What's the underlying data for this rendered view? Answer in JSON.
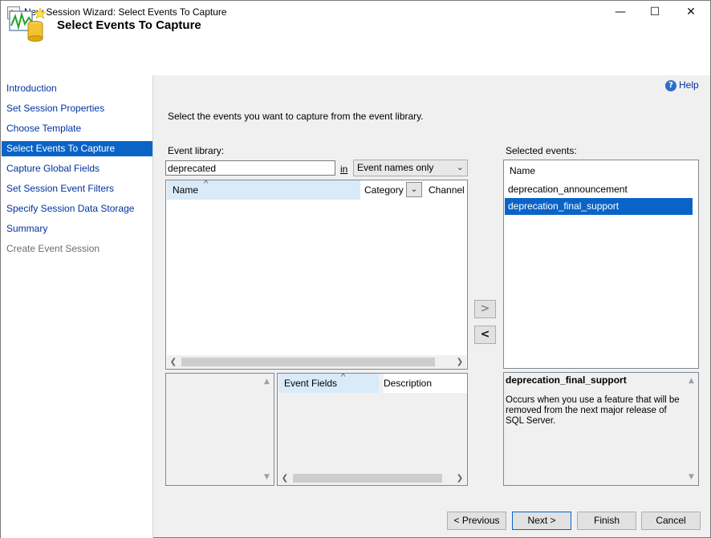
{
  "window": {
    "title": "New Session Wizard: Select Events To Capture",
    "minimize_glyph": "—",
    "maximize_glyph": "☐",
    "close_glyph": "✕"
  },
  "header": {
    "title": "Select Events To Capture",
    "icon": "wizard-chart-database-icon"
  },
  "nav": {
    "items": [
      {
        "label": "Introduction",
        "state": "link"
      },
      {
        "label": "Set Session Properties",
        "state": "link"
      },
      {
        "label": "Choose Template",
        "state": "link"
      },
      {
        "label": "Select Events To Capture",
        "state": "active"
      },
      {
        "label": "Capture Global Fields",
        "state": "link"
      },
      {
        "label": "Set Session Event Filters",
        "state": "link"
      },
      {
        "label": "Specify Session Data Storage",
        "state": "link"
      },
      {
        "label": "Summary",
        "state": "link"
      },
      {
        "label": "Create Event Session",
        "state": "disabled"
      }
    ]
  },
  "help": {
    "label": "Help",
    "icon": "help-icon"
  },
  "main": {
    "instructions": "Select the events you want to capture from the event library.",
    "library_label": "Event library:",
    "search": {
      "value": "deprecated",
      "in_label": "in"
    },
    "scope": {
      "selected": "Event names only"
    },
    "library_columns": {
      "name": "Name",
      "category": "Category",
      "channel": "Channel"
    },
    "add_glyph": ">",
    "remove_glyph": "<",
    "fields_columns": {
      "fields": "Event Fields",
      "description": "Description"
    },
    "selected_label": "Selected events:",
    "selected_events": {
      "header": "Name",
      "rows": [
        "deprecation_announcement",
        "deprecation_final_support"
      ],
      "selected_index": 1
    },
    "description": {
      "title": "deprecation_final_support",
      "text": "Occurs when you use a feature that will be removed from the next major release of SQL Server."
    }
  },
  "footer": {
    "previous": "< Previous",
    "next": "Next >",
    "finish": "Finish",
    "cancel": "Cancel"
  },
  "colors": {
    "accent": "#0a64c8",
    "link": "#0033a0",
    "header_highlight": "#d9eaf9"
  }
}
